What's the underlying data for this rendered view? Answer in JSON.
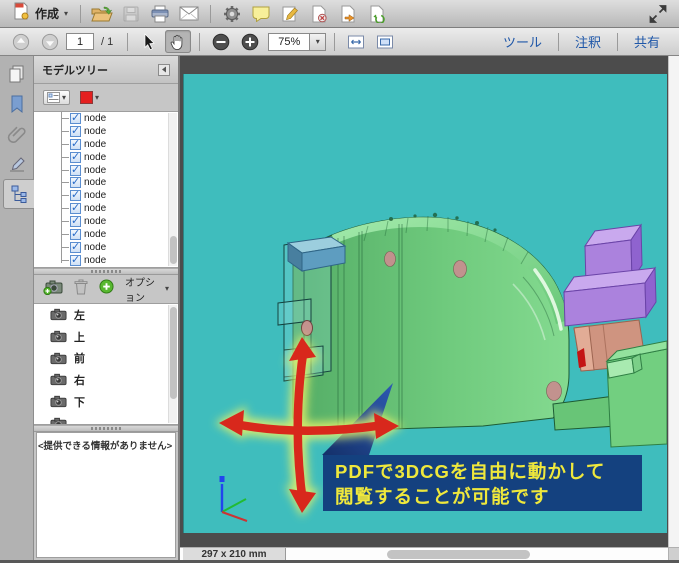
{
  "toolbar_top": {
    "create_label": "作成"
  },
  "toolbar_nav": {
    "page_current": "1",
    "page_total_label": "/ 1",
    "zoom_value": "75%",
    "tools_label": "ツール",
    "comments_label": "注釈",
    "share_label": "共有"
  },
  "model_tree_panel": {
    "title": "モデルツリー",
    "nodes": [
      "node",
      "node",
      "node",
      "node",
      "node",
      "node",
      "node",
      "node",
      "node",
      "node",
      "node",
      "node"
    ],
    "options_label": "オプション",
    "views": [
      "左",
      "上",
      "前",
      "右",
      "下"
    ],
    "no_info_label": "<提供できる情報がありません>"
  },
  "viewport": {
    "banner_line1": "PDFで3DCGを自由に動かして",
    "banner_line2": "閲覧することが可能です",
    "page_size": "297 x 210 mm"
  },
  "colors": {
    "viewport_bg": "#3fbdbd",
    "canvas_bg": "#4c4c4c",
    "banner_bg": "#14417f",
    "banner_text": "#efe83c",
    "model_green": "#6fcf7f",
    "model_purple": "#ab82dd",
    "model_salmon": "#cf9480",
    "model_blue": "#5e9dc0",
    "arrow_red": "#d8281c",
    "arrow_glow": "#dff06a",
    "link_blue": "#1f57a8"
  }
}
